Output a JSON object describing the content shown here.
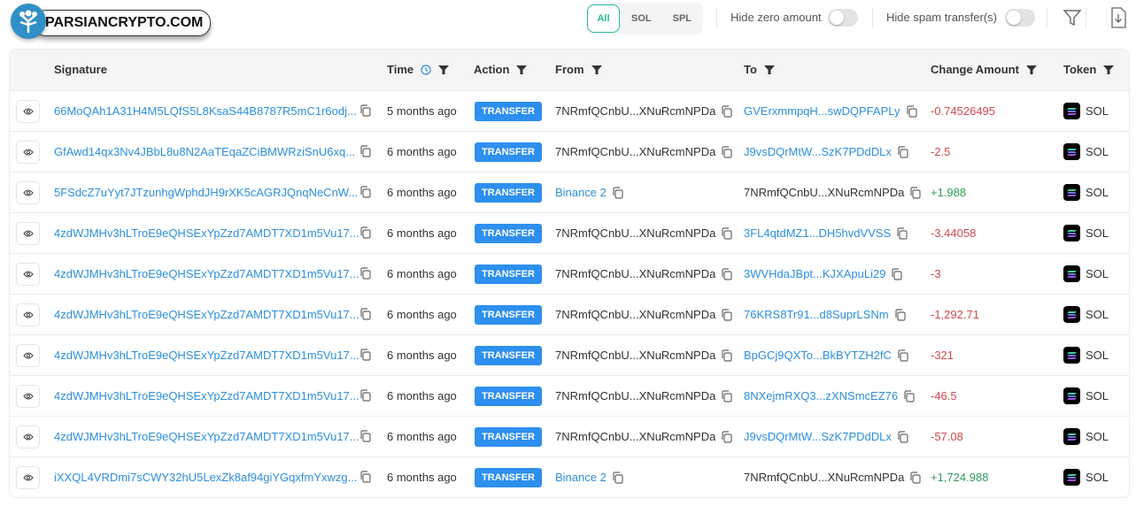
{
  "watermark": {
    "text": "PARSIANCRYPTO.COM"
  },
  "filters": {
    "tabs": [
      "All",
      "SOL",
      "SPL"
    ],
    "active": "All",
    "hide_zero_label": "Hide zero amount",
    "hide_zero_on": false,
    "hide_spam_label": "Hide spam transfer(s)",
    "hide_spam_on": false
  },
  "colors": {
    "accent": "#26b89a",
    "link": "#2d8fdb",
    "badge": "#2d8fef",
    "negative": "#d0494c",
    "positive": "#2e9f57"
  },
  "table": {
    "headers": {
      "signature": "Signature",
      "time": "Time",
      "action": "Action",
      "from": "From",
      "to": "To",
      "change": "Change Amount",
      "token": "Token"
    },
    "rows": [
      {
        "signature": "66MoQAh1A31H4M5LQfS5L8KsaS44B8787R5mC1r6odj...",
        "time": "5 months ago",
        "action": "TRANSFER",
        "from": "7NRmfQCnbU...XNuRcmNPDa",
        "from_link": false,
        "to": "GVErxmmpqH...swDQPFAPLy",
        "to_link": true,
        "change": "-0.74526495",
        "token": "SOL"
      },
      {
        "signature": "GfAwd14qx3Nv4JBbL8u8N2AaTEqaZCiBMWRziSnU6xq...",
        "time": "6 months ago",
        "action": "TRANSFER",
        "from": "7NRmfQCnbU...XNuRcmNPDa",
        "from_link": false,
        "to": "J9vsDQrMtW...SzK7PDdDLx",
        "to_link": true,
        "change": "-2.5",
        "token": "SOL"
      },
      {
        "signature": "5FSdcZ7uYyt7JTzunhgWphdJH9rXK5cAGRJQnqNeCnW...",
        "time": "6 months ago",
        "action": "TRANSFER",
        "from": "Binance 2",
        "from_link": true,
        "to": "7NRmfQCnbU...XNuRcmNPDa",
        "to_link": false,
        "change": "+1.988",
        "token": "SOL"
      },
      {
        "signature": "4zdWJMHv3hLTroE9eQHSExYpZzd7AMDT7XD1m5Vu17...",
        "time": "6 months ago",
        "action": "TRANSFER",
        "from": "7NRmfQCnbU...XNuRcmNPDa",
        "from_link": false,
        "to": "3FL4qtdMZ1...DH5hvdVVSS",
        "to_link": true,
        "change": "-3.44058",
        "token": "SOL"
      },
      {
        "signature": "4zdWJMHv3hLTroE9eQHSExYpZzd7AMDT7XD1m5Vu17...",
        "time": "6 months ago",
        "action": "TRANSFER",
        "from": "7NRmfQCnbU...XNuRcmNPDa",
        "from_link": false,
        "to": "3WVHdaJBpt...KJXApuLi29",
        "to_link": true,
        "change": "-3",
        "token": "SOL"
      },
      {
        "signature": "4zdWJMHv3hLTroE9eQHSExYpZzd7AMDT7XD1m5Vu17...",
        "time": "6 months ago",
        "action": "TRANSFER",
        "from": "7NRmfQCnbU...XNuRcmNPDa",
        "from_link": false,
        "to": "76KRS8Tr91...d8SuprLSNm",
        "to_link": true,
        "change": "-1,292.71",
        "token": "SOL"
      },
      {
        "signature": "4zdWJMHv3hLTroE9eQHSExYpZzd7AMDT7XD1m5Vu17...",
        "time": "6 months ago",
        "action": "TRANSFER",
        "from": "7NRmfQCnbU...XNuRcmNPDa",
        "from_link": false,
        "to": "BpGCj9QXTo...BkBYTZH2fC",
        "to_link": true,
        "change": "-321",
        "token": "SOL"
      },
      {
        "signature": "4zdWJMHv3hLTroE9eQHSExYpZzd7AMDT7XD1m5Vu17...",
        "time": "6 months ago",
        "action": "TRANSFER",
        "from": "7NRmfQCnbU...XNuRcmNPDa",
        "from_link": false,
        "to": "8NXejmRXQ3...zXNSmcEZ76",
        "to_link": true,
        "change": "-46.5",
        "token": "SOL"
      },
      {
        "signature": "4zdWJMHv3hLTroE9eQHSExYpZzd7AMDT7XD1m5Vu17...",
        "time": "6 months ago",
        "action": "TRANSFER",
        "from": "7NRmfQCnbU...XNuRcmNPDa",
        "from_link": false,
        "to": "J9vsDQrMtW...SzK7PDdDLx",
        "to_link": true,
        "change": "-57.08",
        "token": "SOL"
      },
      {
        "signature": "iXXQL4VRDmi7sCWY32hU5LexZk8af94giYGqxfmYxwzg...",
        "time": "6 months ago",
        "action": "TRANSFER",
        "from": "Binance 2",
        "from_link": true,
        "to": "7NRmfQCnbU...XNuRcmNPDa",
        "to_link": false,
        "change": "+1,724.988",
        "token": "SOL"
      }
    ]
  }
}
